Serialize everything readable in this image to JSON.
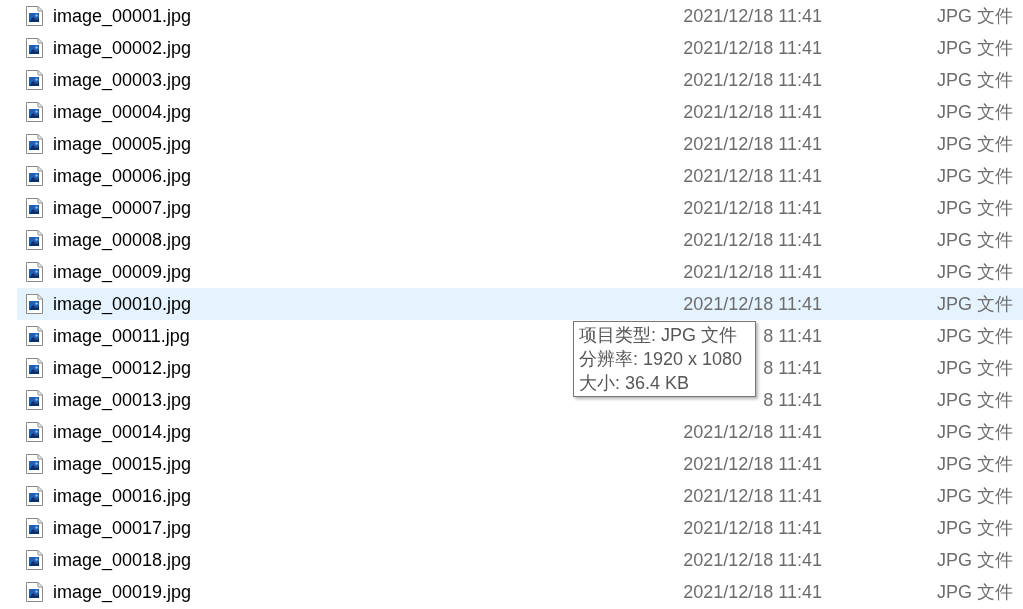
{
  "files": [
    {
      "name": "image_00001.jpg",
      "date": "2021/12/18 11:41",
      "type": "JPG 文件",
      "hovered": false
    },
    {
      "name": "image_00002.jpg",
      "date": "2021/12/18 11:41",
      "type": "JPG 文件",
      "hovered": false
    },
    {
      "name": "image_00003.jpg",
      "date": "2021/12/18 11:41",
      "type": "JPG 文件",
      "hovered": false
    },
    {
      "name": "image_00004.jpg",
      "date": "2021/12/18 11:41",
      "type": "JPG 文件",
      "hovered": false
    },
    {
      "name": "image_00005.jpg",
      "date": "2021/12/18 11:41",
      "type": "JPG 文件",
      "hovered": false
    },
    {
      "name": "image_00006.jpg",
      "date": "2021/12/18 11:41",
      "type": "JPG 文件",
      "hovered": false
    },
    {
      "name": "image_00007.jpg",
      "date": "2021/12/18 11:41",
      "type": "JPG 文件",
      "hovered": false
    },
    {
      "name": "image_00008.jpg",
      "date": "2021/12/18 11:41",
      "type": "JPG 文件",
      "hovered": false
    },
    {
      "name": "image_00009.jpg",
      "date": "2021/12/18 11:41",
      "type": "JPG 文件",
      "hovered": false
    },
    {
      "name": "image_00010.jpg",
      "date": "2021/12/18 11:41",
      "type": "JPG 文件",
      "hovered": true
    },
    {
      "name": "image_00011.jpg",
      "date": "8 11:41",
      "type": "JPG 文件",
      "hovered": false
    },
    {
      "name": "image_00012.jpg",
      "date": "8 11:41",
      "type": "JPG 文件",
      "hovered": false
    },
    {
      "name": "image_00013.jpg",
      "date": "8 11:41",
      "type": "JPG 文件",
      "hovered": false
    },
    {
      "name": "image_00014.jpg",
      "date": "2021/12/18 11:41",
      "type": "JPG 文件",
      "hovered": false
    },
    {
      "name": "image_00015.jpg",
      "date": "2021/12/18 11:41",
      "type": "JPG 文件",
      "hovered": false
    },
    {
      "name": "image_00016.jpg",
      "date": "2021/12/18 11:41",
      "type": "JPG 文件",
      "hovered": false
    },
    {
      "name": "image_00017.jpg",
      "date": "2021/12/18 11:41",
      "type": "JPG 文件",
      "hovered": false
    },
    {
      "name": "image_00018.jpg",
      "date": "2021/12/18 11:41",
      "type": "JPG 文件",
      "hovered": false
    },
    {
      "name": "image_00019.jpg",
      "date": "2021/12/18 11:41",
      "type": "JPG 文件",
      "hovered": false
    }
  ],
  "tooltip": {
    "lines": [
      "项目类型: JPG 文件",
      "分辨率: 1920 x 1080",
      "大小: 36.4 KB"
    ]
  }
}
